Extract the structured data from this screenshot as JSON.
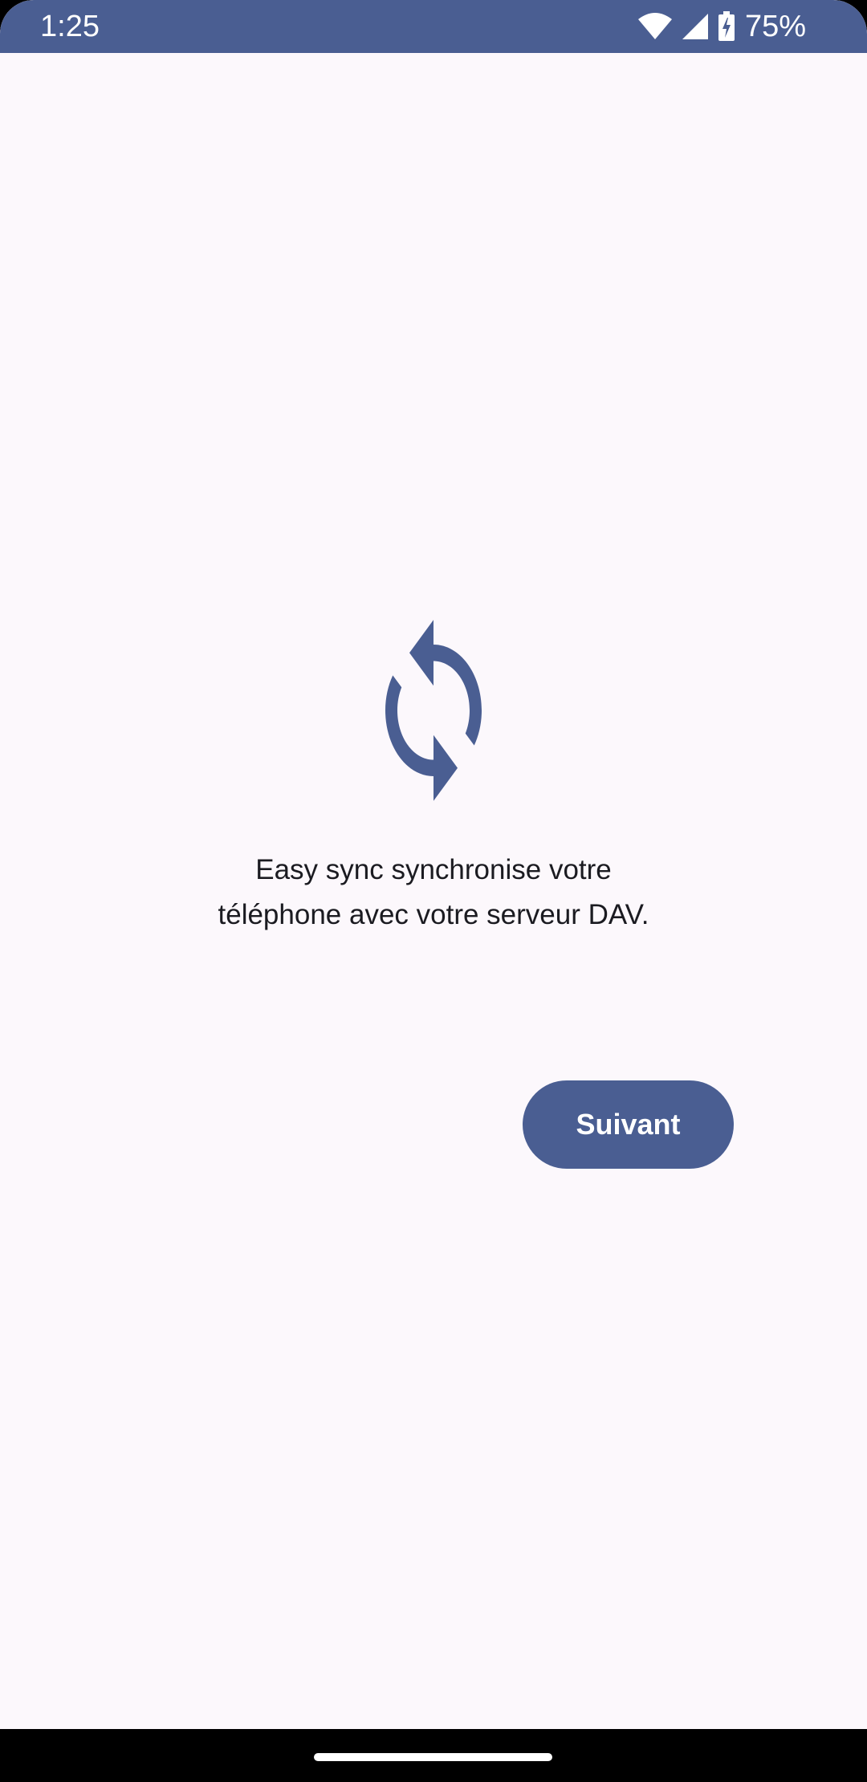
{
  "status_bar": {
    "time": "1:25",
    "battery": "75%",
    "icons": [
      "wifi-icon",
      "cellular-signal-icon",
      "battery-charging-icon"
    ]
  },
  "main": {
    "icon": "sync-icon",
    "intro_line_1": "Easy sync synchronise votre",
    "intro_line_2": "téléphone avec votre serveur DAV.",
    "next_label": "Suivant"
  },
  "colors": {
    "primary": "#4a5e92",
    "background": "#fcf8fc",
    "text": "#1b1b21",
    "on_primary": "#ffffff"
  }
}
